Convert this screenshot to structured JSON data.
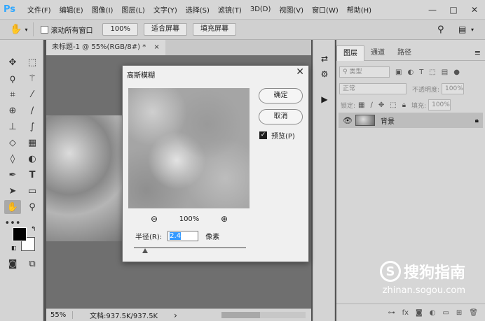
{
  "app": {
    "logo": "Ps"
  },
  "menu": [
    "文件(F)",
    "编辑(E)",
    "图像(I)",
    "图层(L)",
    "文字(Y)",
    "选择(S)",
    "滤镜(T)",
    "3D(D)",
    "视图(V)",
    "窗口(W)",
    "帮助(H)"
  ],
  "window_controls": {
    "minimize": "—",
    "restore": "□",
    "close": "✕"
  },
  "options": {
    "tool_icon": "hand-icon",
    "scroll_all_label": "滚动所有窗口",
    "zoom_100": "100%",
    "fit_screen": "适合屏幕",
    "fill_screen": "填充屏幕"
  },
  "document": {
    "tab_title": "未标题-1 @ 55%(RGB/8#) *",
    "tab_close": "×",
    "status_zoom": "55%",
    "status_doc": "文档:937.5K/937.5K",
    "status_arrow": "›"
  },
  "layers_panel": {
    "tabs": [
      "图层",
      "通道",
      "路径"
    ],
    "filter_kind": "类型",
    "blend_mode": "正常",
    "opacity_label": "不透明度:",
    "opacity_value": "100%",
    "lock_label": "锁定:",
    "fill_label": "填充:",
    "fill_value": "100%",
    "layer_name": "背景"
  },
  "dialog": {
    "title": "高斯模糊",
    "close": "✕",
    "ok": "确定",
    "cancel": "取消",
    "preview_label": "预览(P)",
    "preview_checked": true,
    "zoom_level": "100%",
    "radius_label": "半径(R):",
    "radius_value": "2.4",
    "radius_unit": "像素"
  },
  "watermark": {
    "logo": "S",
    "text": "搜狗指南",
    "url": "zhinan.sogou.com"
  }
}
